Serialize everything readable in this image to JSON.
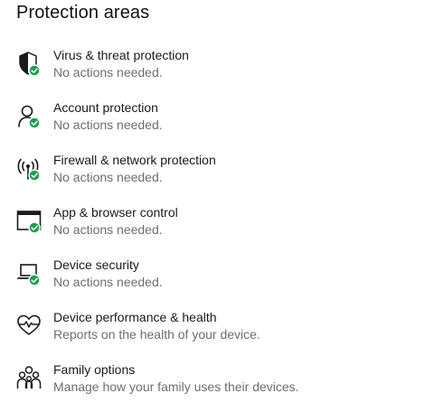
{
  "section_title": "Protection areas",
  "status_color": "#16a34a",
  "areas": [
    {
      "icon": "shield-icon",
      "title": "Virus & threat protection",
      "status": "No actions needed.",
      "ok": true
    },
    {
      "icon": "person-icon",
      "title": "Account protection",
      "status": "No actions needed.",
      "ok": true
    },
    {
      "icon": "antenna-icon",
      "title": "Firewall & network protection",
      "status": "No actions needed.",
      "ok": true
    },
    {
      "icon": "browser-window-icon",
      "title": "App & browser control",
      "status": "No actions needed.",
      "ok": true
    },
    {
      "icon": "laptop-chip-icon",
      "title": "Device security",
      "status": "No actions needed.",
      "ok": true
    },
    {
      "icon": "heart-pulse-icon",
      "title": "Device performance & health",
      "status": "Reports on the health of your device.",
      "ok": false
    },
    {
      "icon": "family-icon",
      "title": "Family options",
      "status": "Manage how your family uses their devices.",
      "ok": false
    }
  ]
}
